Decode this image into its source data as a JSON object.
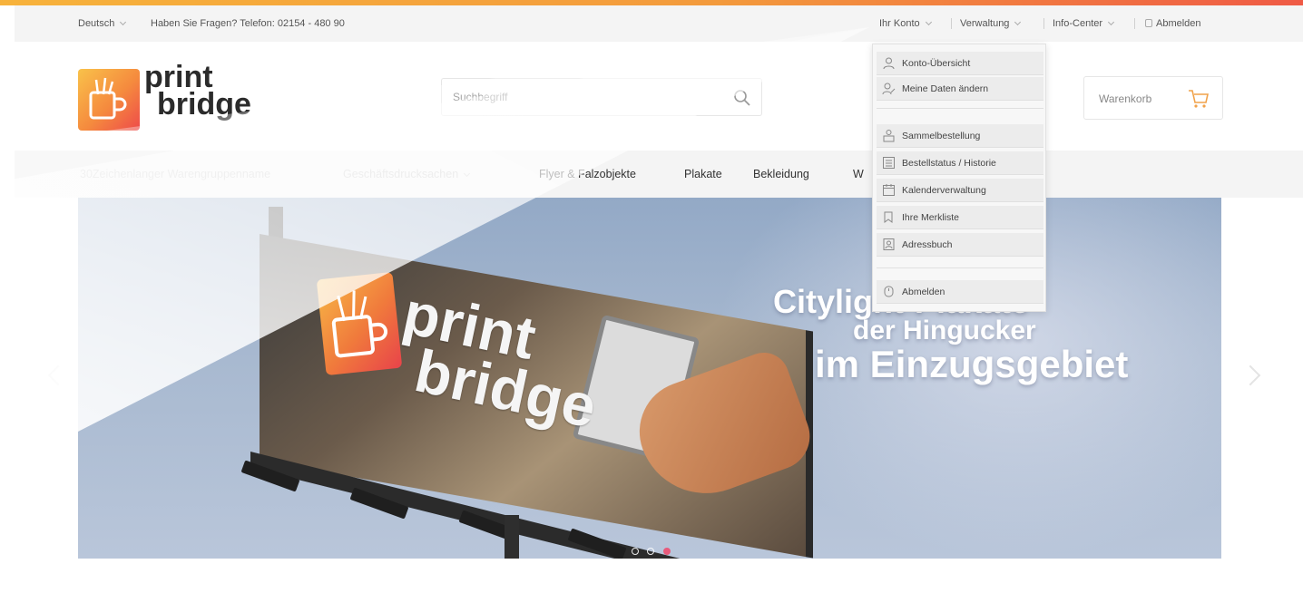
{
  "topbar": {
    "language": "Deutsch",
    "contact": "Haben Sie Fragen? Telefon: 02154 - 480 90",
    "account": "Ihr Konto",
    "administration": "Verwaltung",
    "info_center": "Info-Center",
    "logout": "Abmelden"
  },
  "header": {
    "logo_line1": "print",
    "logo_line2": "bridge",
    "search_placeholder": "Suchbegriff",
    "cart_label": "Warenkorb"
  },
  "nav": {
    "items": [
      "30Zeichenlanger Warengruppenname",
      "Geschäftsdrucksachen",
      "Flyer & Falzobjekte",
      "Plakate",
      "Bekleidung",
      "W"
    ]
  },
  "dropdown": {
    "items": [
      {
        "label": "Konto-Übersicht",
        "icon": "user-icon"
      },
      {
        "label": "Meine Daten ändern",
        "icon": "user-edit-icon"
      },
      {
        "label": "Sammelbestellung",
        "icon": "bulk-order-icon"
      },
      {
        "label": "Bestellstatus / Historie",
        "icon": "order-history-icon"
      },
      {
        "label": "Kalenderverwaltung",
        "icon": "calendar-icon"
      },
      {
        "label": "Ihre Merkliste",
        "icon": "wishlist-icon"
      },
      {
        "label": "Adressbuch",
        "icon": "address-book-icon"
      },
      {
        "label": "Abmelden",
        "icon": "logout-icon"
      }
    ]
  },
  "hero": {
    "billboard_line1": "print",
    "billboard_line2": "bridge",
    "headline_1": "Citylight-Plakate",
    "headline_2": "der Hingucker",
    "headline_3": "im Einzugsgebiet",
    "slides_total": 3,
    "active_slide": 3
  },
  "colors": {
    "accent": "#f39a3c",
    "accent_red": "#ef5a45",
    "dot_active": "#e85b7c"
  }
}
